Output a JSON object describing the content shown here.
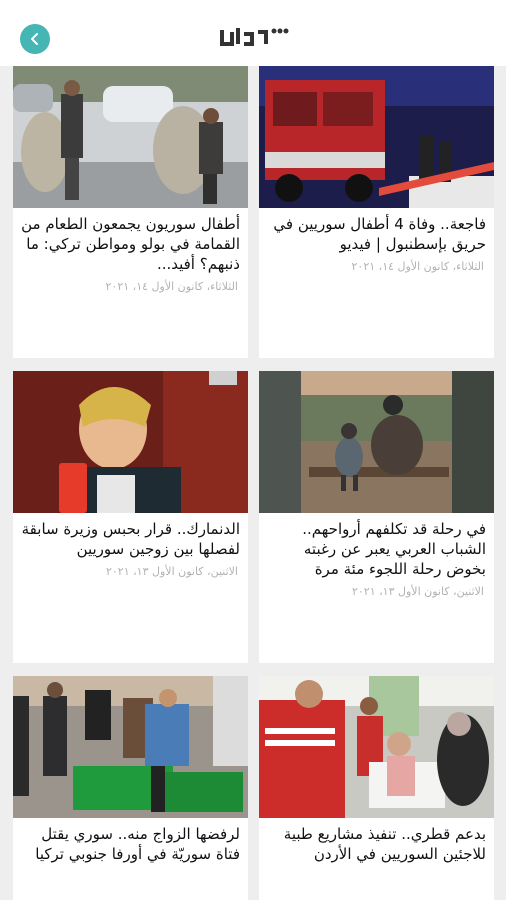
{
  "header": {
    "logo_text": "٢١ عربي"
  },
  "articles": [
    {
      "title": "فاجعة.. وفاة 4 أطفال سوريين في حريق بإسطنبول | فيديو",
      "date": "الثلاثاء، كانون الأول ١٤، ٢٠٢١"
    },
    {
      "title": "أطفال سوريون يجمعون الطعام من القمامة في بولو ومواطن تركي: ما ذنبهم؟ أفيد...",
      "date": "الثلاثاء، كانون الأول ١٤، ٢٠٢١"
    },
    {
      "title": "في رحلة قد تكلفهم أرواحهم.. الشباب العربي يعبر عن رغبته بخوض رحلة اللجوء مئة مرة",
      "date": "الاثنين، كانون الأول ١٣، ٢٠٢١"
    },
    {
      "title": "الدنمارك.. قرار بحبس وزيرة سابقة لفصلها بين زوجين سوريين",
      "date": "الاثنين، كانون الأول ١٣، ٢٠٢١"
    },
    {
      "title": "بدعم قطري.. تنفيذ مشاريع طبية للاجئين السوريين في الأردن",
      "date": ""
    },
    {
      "title": "لرفضها الزواج منه.. سوري يقتل فتاة سوريّة في أورفا جنوبي تركيا",
      "date": ""
    }
  ]
}
